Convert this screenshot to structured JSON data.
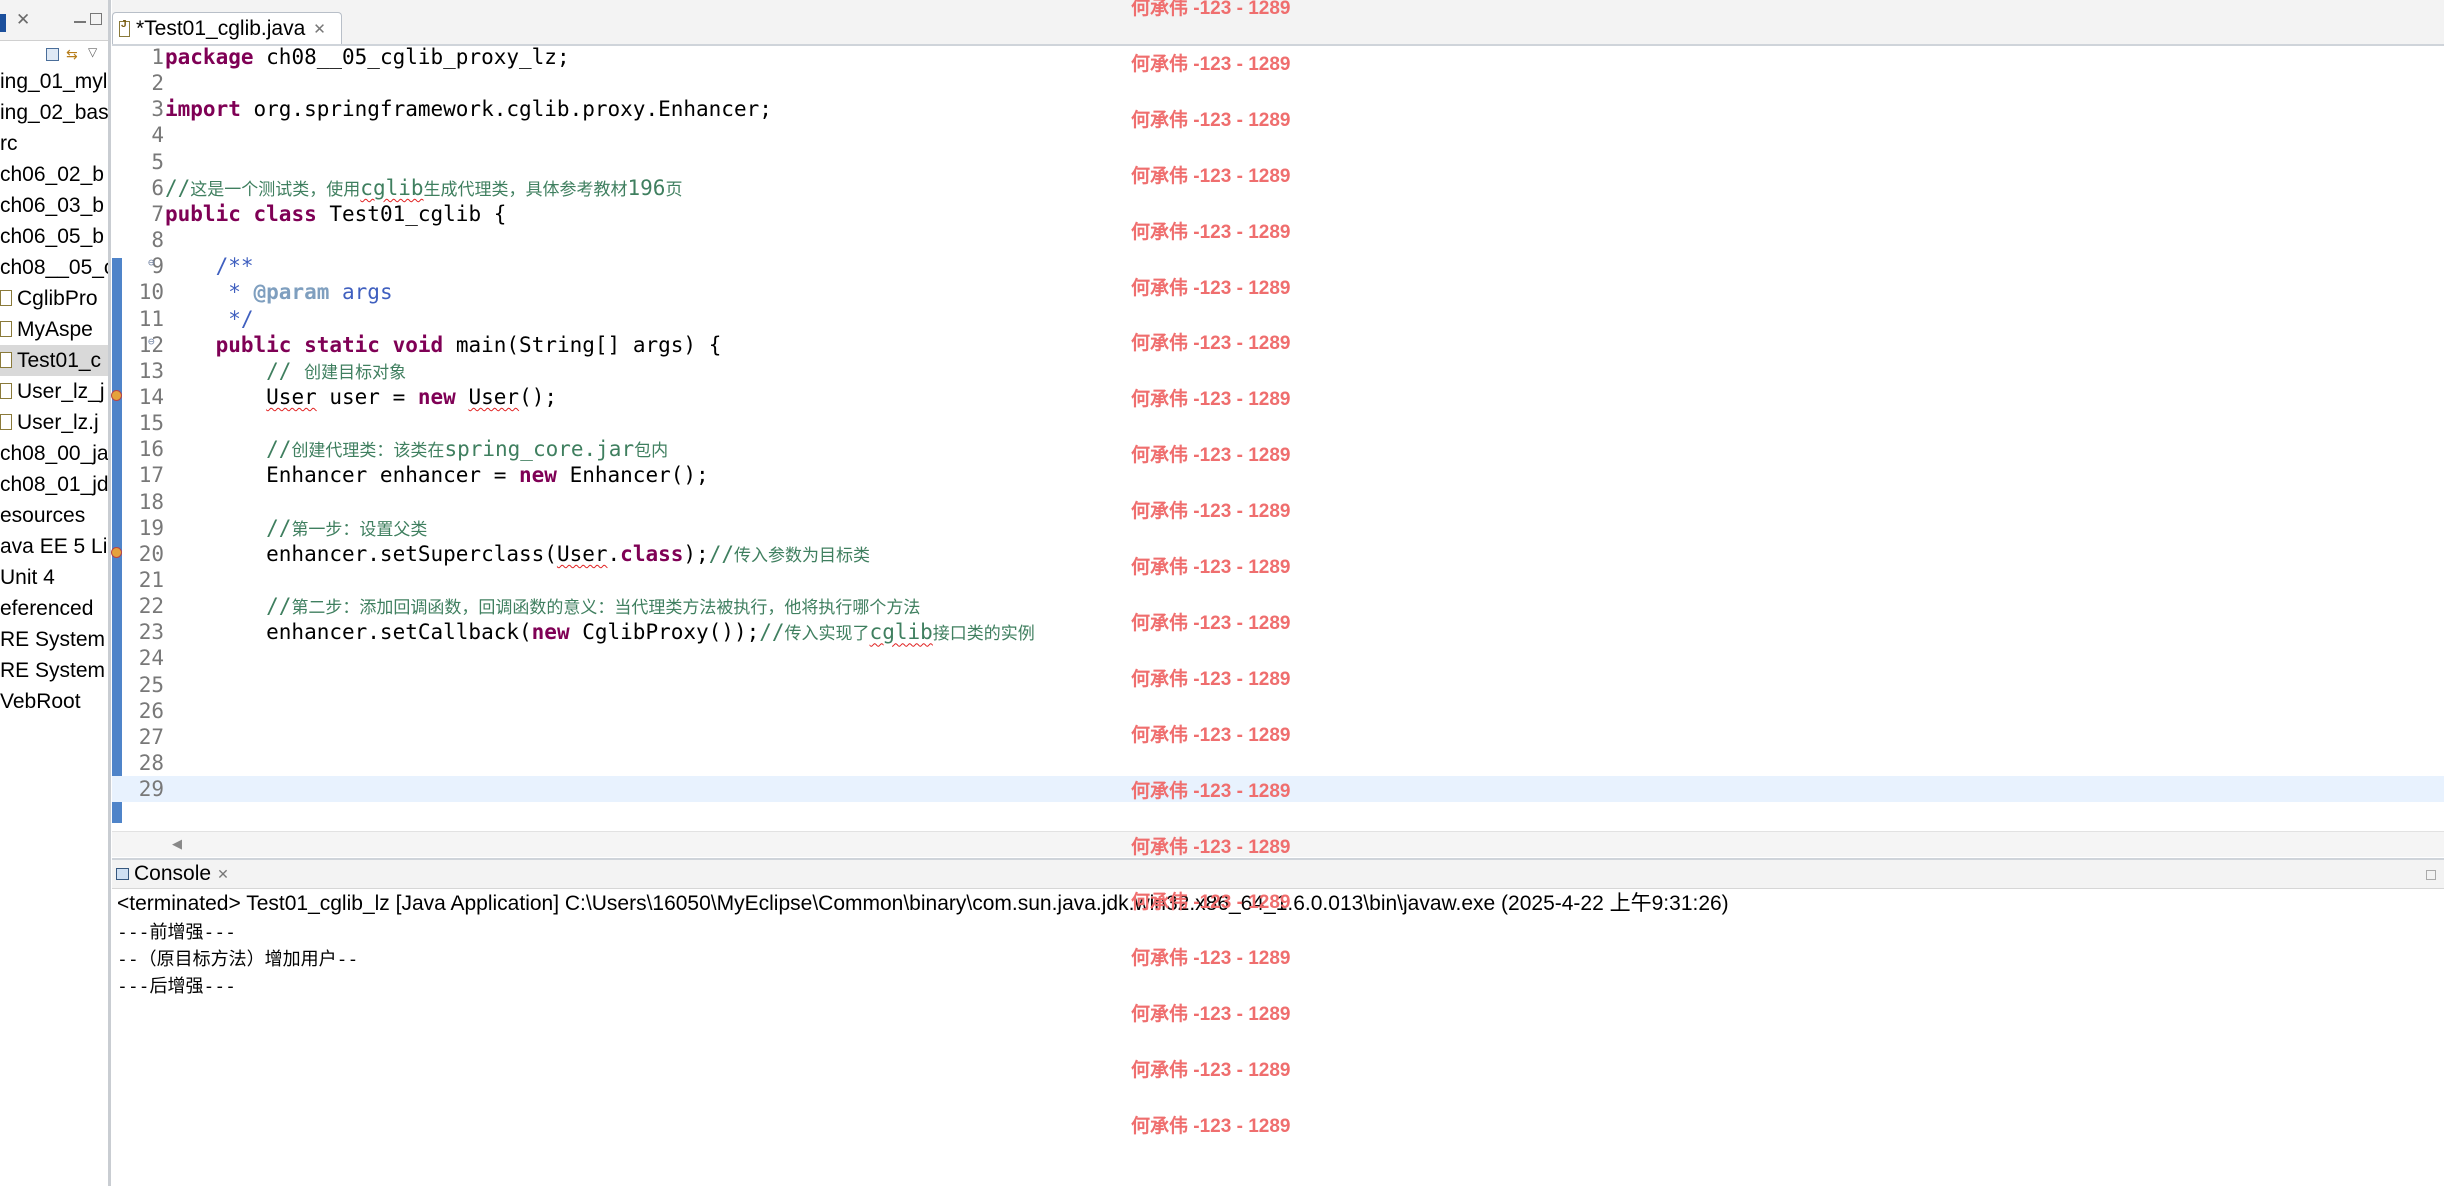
{
  "package_explorer": {
    "items": [
      {
        "label": "ing_01_myl",
        "selected": false,
        "icon": null
      },
      {
        "label": "ing_02_bas",
        "selected": false,
        "icon": null
      },
      {
        "label": "rc",
        "selected": false,
        "icon": null
      },
      {
        "label": " ch06_02_b",
        "selected": false,
        "icon": null
      },
      {
        "label": " ch06_03_b",
        "selected": false,
        "icon": null
      },
      {
        "label": " ch06_05_b",
        "selected": false,
        "icon": null
      },
      {
        "label": " ch08__05_c",
        "selected": false,
        "icon": null
      },
      {
        "label": "CglibPro",
        "selected": false,
        "icon": "java-file-icon"
      },
      {
        "label": "MyAspe",
        "selected": false,
        "icon": "java-file-icon"
      },
      {
        "label": "Test01_c",
        "selected": true,
        "icon": "java-file-icon"
      },
      {
        "label": "User_lz_j",
        "selected": false,
        "icon": "java-file-icon"
      },
      {
        "label": "User_lz.j",
        "selected": false,
        "icon": "java-file-icon"
      },
      {
        "label": " ch08_00_ja",
        "selected": false,
        "icon": null
      },
      {
        "label": " ch08_01_jd",
        "selected": false,
        "icon": null
      },
      {
        "label": "esources",
        "selected": false,
        "icon": null
      },
      {
        "label": "ava EE 5 Lib",
        "selected": false,
        "icon": null
      },
      {
        "label": "Unit 4",
        "selected": false,
        "icon": null
      },
      {
        "label": "eferenced",
        "selected": false,
        "icon": null
      },
      {
        "label": "RE System",
        "selected": false,
        "icon": null
      },
      {
        "label": "RE System",
        "selected": false,
        "icon": null
      },
      {
        "label": "VebRoot",
        "selected": false,
        "icon": null
      }
    ]
  },
  "editor": {
    "tab_title": "*Test01_cglib.java",
    "current_line": 29,
    "lines": [
      {
        "n": "1",
        "segs": [
          {
            "t": "package",
            "c": "kw"
          },
          {
            "t": " ch08__05_cglib_proxy_lz;",
            "c": ""
          }
        ]
      },
      {
        "n": "2",
        "segs": []
      },
      {
        "n": "3",
        "segs": [
          {
            "t": "import",
            "c": "kw"
          },
          {
            "t": " org.springframework.cglib.proxy.Enhancer;",
            "c": ""
          }
        ]
      },
      {
        "n": "4",
        "segs": []
      },
      {
        "n": "5",
        "segs": []
      },
      {
        "n": "6",
        "segs": [
          {
            "t": "//",
            "c": "cmt"
          },
          {
            "t": "这是一个测试类，使用",
            "c": "cmt cjk"
          },
          {
            "t": "cglib",
            "c": "cmt squig"
          },
          {
            "t": "生成代理类，具体参考教材",
            "c": "cmt cjk"
          },
          {
            "t": "196",
            "c": "cmt"
          },
          {
            "t": "页",
            "c": "cmt cjk"
          }
        ]
      },
      {
        "n": "7",
        "segs": [
          {
            "t": "public",
            "c": "kw"
          },
          {
            "t": " ",
            "c": ""
          },
          {
            "t": "class",
            "c": "kw"
          },
          {
            "t": " Test01_cglib {",
            "c": ""
          }
        ]
      },
      {
        "n": "8",
        "segs": []
      },
      {
        "n": "9",
        "fold": true,
        "segs": [
          {
            "t": "    /**",
            "c": "doc"
          }
        ]
      },
      {
        "n": "10",
        "segs": [
          {
            "t": "     * ",
            "c": "doc"
          },
          {
            "t": "@param",
            "c": "tag"
          },
          {
            "t": " args",
            "c": "doc"
          }
        ]
      },
      {
        "n": "11",
        "segs": [
          {
            "t": "     */",
            "c": "doc"
          }
        ]
      },
      {
        "n": "12",
        "fold": true,
        "segs": [
          {
            "t": "    ",
            "c": ""
          },
          {
            "t": "public",
            "c": "kw"
          },
          {
            "t": " ",
            "c": ""
          },
          {
            "t": "static",
            "c": "kw"
          },
          {
            "t": " ",
            "c": ""
          },
          {
            "t": "void",
            "c": "kw"
          },
          {
            "t": " main(String[] args) {",
            "c": ""
          }
        ]
      },
      {
        "n": "13",
        "segs": [
          {
            "t": "        // ",
            "c": "cmt"
          },
          {
            "t": "创建目标对象",
            "c": "cmt cjk"
          }
        ]
      },
      {
        "n": "14",
        "error": true,
        "segs": [
          {
            "t": "        ",
            "c": ""
          },
          {
            "t": "User",
            "c": "squig"
          },
          {
            "t": " user = ",
            "c": ""
          },
          {
            "t": "new",
            "c": "kw"
          },
          {
            "t": " ",
            "c": ""
          },
          {
            "t": "User",
            "c": "squig"
          },
          {
            "t": "();",
            "c": ""
          }
        ]
      },
      {
        "n": "15",
        "segs": []
      },
      {
        "n": "16",
        "segs": [
          {
            "t": "        //",
            "c": "cmt"
          },
          {
            "t": "创建代理类：该类在",
            "c": "cmt cjk"
          },
          {
            "t": "spring_core.jar",
            "c": "cmt"
          },
          {
            "t": "包内",
            "c": "cmt cjk"
          }
        ]
      },
      {
        "n": "17",
        "segs": [
          {
            "t": "        Enhancer enhancer = ",
            "c": ""
          },
          {
            "t": "new",
            "c": "kw"
          },
          {
            "t": " Enhancer();",
            "c": ""
          }
        ]
      },
      {
        "n": "18",
        "segs": []
      },
      {
        "n": "19",
        "segs": [
          {
            "t": "        //",
            "c": "cmt"
          },
          {
            "t": "第一步：设置父类",
            "c": "cmt cjk"
          }
        ]
      },
      {
        "n": "20",
        "error": true,
        "segs": [
          {
            "t": "        enhancer.setSuperclass(",
            "c": ""
          },
          {
            "t": "User",
            "c": "squig"
          },
          {
            "t": ".",
            "c": ""
          },
          {
            "t": "class",
            "c": "kw"
          },
          {
            "t": ");",
            "c": ""
          },
          {
            "t": "//",
            "c": "cmt"
          },
          {
            "t": "传入参数为目标类",
            "c": "cmt cjk"
          }
        ]
      },
      {
        "n": "21",
        "segs": []
      },
      {
        "n": "22",
        "segs": [
          {
            "t": "        //",
            "c": "cmt"
          },
          {
            "t": "第二步：添加回调函数，回调函数的意义：当代理类方法被执行，他将执行哪个方法",
            "c": "cmt cjk"
          }
        ]
      },
      {
        "n": "23",
        "segs": [
          {
            "t": "        enhancer.setCallback(",
            "c": ""
          },
          {
            "t": "new",
            "c": "kw"
          },
          {
            "t": " CglibProxy());",
            "c": ""
          },
          {
            "t": "//",
            "c": "cmt"
          },
          {
            "t": "传入实现了",
            "c": "cmt cjk"
          },
          {
            "t": "cglib",
            "c": "cmt squig"
          },
          {
            "t": "接口类的实例",
            "c": "cmt cjk"
          }
        ]
      },
      {
        "n": "24",
        "segs": []
      },
      {
        "n": "25",
        "segs": []
      },
      {
        "n": "26",
        "segs": []
      },
      {
        "n": "27",
        "segs": []
      },
      {
        "n": "28",
        "segs": []
      },
      {
        "n": "29",
        "segs": []
      }
    ]
  },
  "console": {
    "tab_label": "Console",
    "header": "<terminated> Test01_cglib_lz [Java Application] C:\\Users\\16050\\MyEclipse\\Common\\binary\\com.sun.java.jdk.win32.x86_64_1.6.0.013\\bin\\javaw.exe (2025-4-22 上午9:31:26)",
    "output": [
      "---前增强---",
      "--（原目标方法）增加用户--",
      "---后增强---"
    ]
  },
  "watermark": {
    "text": "何承伟 -123 - 1289",
    "color": "#ef6e6e"
  }
}
